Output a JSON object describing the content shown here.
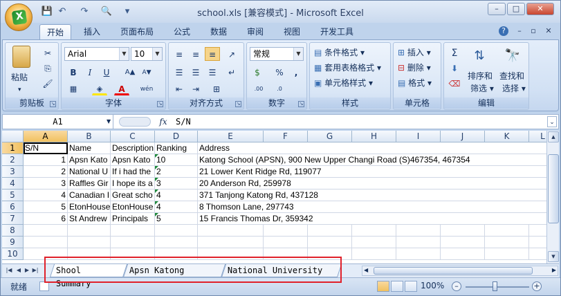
{
  "window": {
    "title": "school.xls  [兼容模式] - Microsoft Excel",
    "minimize": "–",
    "maximize": "□",
    "close": "✕"
  },
  "qat": {
    "save_icon": "💾",
    "undo_icon": "↶",
    "redo_icon": "↷",
    "preview_icon": "🔍",
    "more_icon": "▾"
  },
  "ribbon_tabs": [
    "开始",
    "插入",
    "页面布局",
    "公式",
    "数据",
    "审阅",
    "视图",
    "开发工具"
  ],
  "ribbon_controls": {
    "help": "?",
    "minimize": "–",
    "restore": "▫",
    "close": "✕"
  },
  "groups": {
    "clipboard": {
      "title": "剪贴板",
      "paste": "粘贴",
      "cut_icon": "✂",
      "copy_icon": "⎘",
      "format_painter_icon": "🖌"
    },
    "font": {
      "title": "字体",
      "font_name": "Arial",
      "font_size": "10",
      "bold": "B",
      "italic": "I",
      "underline": "U",
      "grow": "A▲",
      "shrink": "A▼",
      "font_color": "A",
      "phonetic": "wén"
    },
    "alignment": {
      "title": "对齐方式"
    },
    "number": {
      "title": "数字",
      "format": "常规",
      "percent": "%",
      "comma": ",",
      "inc_decimal": ".00",
      "dec_decimal": ".0"
    },
    "styles": {
      "title": "样式",
      "conditional": "条件格式",
      "table": "套用表格格式",
      "cell_styles": "单元格样式"
    },
    "cells": {
      "title": "单元格",
      "insert": "插入",
      "delete": "删除",
      "format": "格式"
    },
    "editing": {
      "title": "编辑",
      "sigma": "Σ",
      "sort": "排序和",
      "sort2": "筛选",
      "find": "查找和",
      "find2": "选择"
    }
  },
  "formula_bar": {
    "name_box": "A1",
    "fx": "fx",
    "content": "S/N"
  },
  "columns": [
    "A",
    "B",
    "C",
    "D",
    "E",
    "F",
    "G",
    "H",
    "I",
    "J",
    "K",
    "L"
  ],
  "rows": [
    "1",
    "2",
    "3",
    "4",
    "5",
    "6",
    "7",
    "8",
    "9",
    "10"
  ],
  "cells": {
    "r1": [
      "S/N",
      "Name",
      "Description",
      "Ranking",
      "Address"
    ],
    "r2": [
      "1",
      "Apsn Kato",
      "Apsn Kato",
      "10",
      "Katong School (APSN), 900 New Upper Changi Road (S)467354, 467354"
    ],
    "r3": [
      "2",
      "National U",
      "If i had the",
      "2",
      "21 Lower Kent Ridge Rd, 119077"
    ],
    "r4": [
      "3",
      "Raffles Gir",
      "I hope its a",
      "3",
      "20 Anderson Rd, 259978"
    ],
    "r5": [
      "4",
      "Canadian I",
      "Great scho",
      "4",
      "371 Tanjong Katong Rd, 437128"
    ],
    "r6": [
      "5",
      "EtonHouse",
      "EtonHouse",
      "4",
      "8 Thomson Lane, 297743"
    ],
    "r7": [
      "6",
      "St Andrew",
      "Principals",
      "5",
      "15 Francis Thomas Dr, 359342"
    ]
  },
  "sheet_tabs": [
    "Shool Summary",
    "Apsn Katong School",
    "National University o"
  ],
  "status": {
    "ready": "就绪",
    "zoom": "100%",
    "zoom_out": "–",
    "zoom_in": "+"
  }
}
